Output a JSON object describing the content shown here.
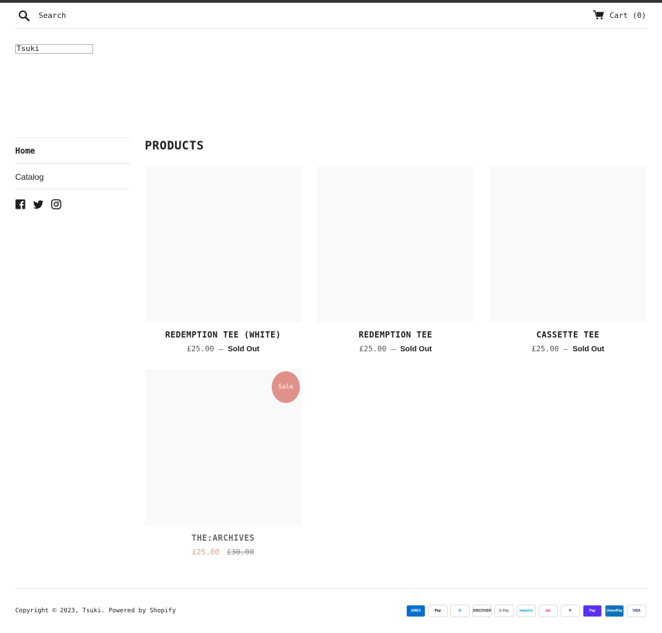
{
  "header": {
    "search_placeholder": "Search",
    "cart_label": "Cart",
    "cart_count": "(0)"
  },
  "logo": {
    "text": "Tsuki"
  },
  "sidebar": {
    "items": [
      {
        "label": "Home",
        "active": true
      },
      {
        "label": "Catalog",
        "active": false
      }
    ],
    "social": [
      "facebook-icon",
      "twitter-icon",
      "instagram-icon"
    ]
  },
  "main": {
    "title": "PRODUCTS",
    "products": [
      {
        "name": "REDEMPTION TEE (WHITE)",
        "price": "£25.00",
        "separator": "—",
        "status": "Sold Out"
      },
      {
        "name": "REDEMPTION TEE",
        "price": "£25.00",
        "separator": "—",
        "status": "Sold Out"
      },
      {
        "name": "CASSETTE TEE",
        "price": "£25.00",
        "separator": "—",
        "status": "Sold Out"
      },
      {
        "name": "THE:ARCHIVES",
        "price": "£25.00",
        "compare_price": "£30.00",
        "badge": "Sale"
      }
    ]
  },
  "footer": {
    "copyright": "Copyright © 2023, Tsuki. Powered by Shopify",
    "payments": [
      {
        "label": "AMEX",
        "bg": "#016fd0",
        "fg": "#ffffff"
      },
      {
        "label": "Pay",
        "bg": "#ffffff",
        "fg": "#000000"
      },
      {
        "label": "D",
        "bg": "#ffffff",
        "fg": "#0079be"
      },
      {
        "label": "DISCOVER",
        "bg": "#ffffff",
        "fg": "#231f20"
      },
      {
        "label": "G Pay",
        "bg": "#ffffff",
        "fg": "#5f6368"
      },
      {
        "label": "maestro",
        "bg": "#ffffff",
        "fg": "#0099df"
      },
      {
        "label": "mc",
        "bg": "#ffffff",
        "fg": "#eb001b"
      },
      {
        "label": "P",
        "bg": "#ffffff",
        "fg": "#003087"
      },
      {
        "label": "Pay",
        "bg": "#5a31f4",
        "fg": "#ffffff"
      },
      {
        "label": "UnionPay",
        "bg": "#0e73b9",
        "fg": "#ffffff"
      },
      {
        "label": "VISA",
        "bg": "#ffffff",
        "fg": "#142688"
      }
    ]
  }
}
